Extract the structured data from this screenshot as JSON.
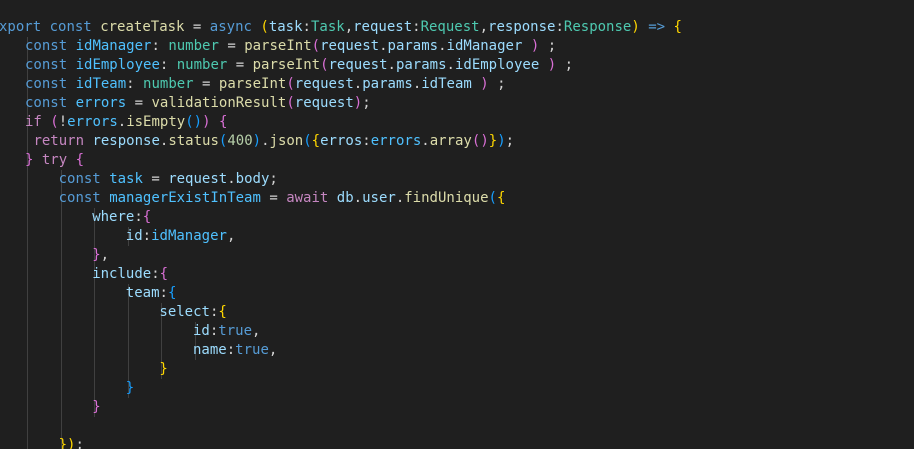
{
  "theme": {
    "background": "#1f1f1f",
    "indent_guide": "#404040",
    "token_colors": {
      "kw": "#569cd6",
      "ctl": "#c586c0",
      "fn": "#dcdcaa",
      "var": "#9cdcfe",
      "const": "#4fc1ff",
      "type": "#4ec9b0",
      "num": "#b5cea8",
      "op": "#d4d4d4",
      "p1": "#ffd700",
      "p2": "#da70d6",
      "p3": "#179fff"
    }
  },
  "code": [
    {
      "indent": 0,
      "tokens": [
        [
          "xport",
          "kw"
        ],
        [
          " ",
          "op"
        ],
        [
          "const",
          "kw"
        ],
        [
          " ",
          "op"
        ],
        [
          "createTask",
          "fn"
        ],
        [
          " = ",
          "op"
        ],
        [
          "async",
          "kw"
        ],
        [
          " ",
          "op"
        ],
        [
          "(",
          "p1"
        ],
        [
          "task",
          "var"
        ],
        [
          ":",
          "op"
        ],
        [
          "Task",
          "type"
        ],
        [
          ",",
          "op"
        ],
        [
          "request",
          "var"
        ],
        [
          ":",
          "op"
        ],
        [
          "Request",
          "type"
        ],
        [
          ",",
          "op"
        ],
        [
          "response",
          "var"
        ],
        [
          ":",
          "op"
        ],
        [
          "Response",
          "type"
        ],
        [
          ")",
          "p1"
        ],
        [
          " ",
          "op"
        ],
        [
          "=>",
          "kw"
        ],
        [
          " ",
          "op"
        ],
        [
          "{",
          "p1"
        ]
      ]
    },
    {
      "indent": 1,
      "tokens": [
        [
          "const",
          "kw"
        ],
        [
          " ",
          "op"
        ],
        [
          "idManager",
          "const"
        ],
        [
          ": ",
          "op"
        ],
        [
          "number",
          "type"
        ],
        [
          " = ",
          "op"
        ],
        [
          "parseInt",
          "fn"
        ],
        [
          "(",
          "p2"
        ],
        [
          "request",
          "var"
        ],
        [
          ".",
          "op"
        ],
        [
          "params",
          "var"
        ],
        [
          ".",
          "op"
        ],
        [
          "idManager",
          "var"
        ],
        [
          " ",
          "op"
        ],
        [
          ")",
          "p2"
        ],
        [
          " ;",
          "op"
        ]
      ]
    },
    {
      "indent": 1,
      "tokens": [
        [
          "const",
          "kw"
        ],
        [
          " ",
          "op"
        ],
        [
          "idEmployee",
          "const"
        ],
        [
          ": ",
          "op"
        ],
        [
          "number",
          "type"
        ],
        [
          " = ",
          "op"
        ],
        [
          "parseInt",
          "fn"
        ],
        [
          "(",
          "p2"
        ],
        [
          "request",
          "var"
        ],
        [
          ".",
          "op"
        ],
        [
          "params",
          "var"
        ],
        [
          ".",
          "op"
        ],
        [
          "idEmployee",
          "var"
        ],
        [
          " ",
          "op"
        ],
        [
          ")",
          "p2"
        ],
        [
          " ;",
          "op"
        ]
      ]
    },
    {
      "indent": 1,
      "tokens": [
        [
          "const",
          "kw"
        ],
        [
          " ",
          "op"
        ],
        [
          "idTeam",
          "const"
        ],
        [
          ": ",
          "op"
        ],
        [
          "number",
          "type"
        ],
        [
          " = ",
          "op"
        ],
        [
          "parseInt",
          "fn"
        ],
        [
          "(",
          "p2"
        ],
        [
          "request",
          "var"
        ],
        [
          ".",
          "op"
        ],
        [
          "params",
          "var"
        ],
        [
          ".",
          "op"
        ],
        [
          "idTeam",
          "var"
        ],
        [
          " ",
          "op"
        ],
        [
          ")",
          "p2"
        ],
        [
          " ;",
          "op"
        ]
      ]
    },
    {
      "indent": 1,
      "tokens": [
        [
          "const",
          "kw"
        ],
        [
          " ",
          "op"
        ],
        [
          "errors",
          "const"
        ],
        [
          " = ",
          "op"
        ],
        [
          "validationResult",
          "fn"
        ],
        [
          "(",
          "p2"
        ],
        [
          "request",
          "var"
        ],
        [
          ")",
          "p2"
        ],
        [
          ";",
          "op"
        ]
      ]
    },
    {
      "indent": 1,
      "tokens": [
        [
          "if",
          "ctl"
        ],
        [
          " ",
          "op"
        ],
        [
          "(",
          "p2"
        ],
        [
          "!",
          "op"
        ],
        [
          "errors",
          "const"
        ],
        [
          ".",
          "op"
        ],
        [
          "isEmpty",
          "fn"
        ],
        [
          "(",
          "p3"
        ],
        [
          ")",
          "p3"
        ],
        [
          ")",
          "p2"
        ],
        [
          " ",
          "op"
        ],
        [
          "{",
          "p2"
        ]
      ]
    },
    {
      "indent": 1,
      "tokens": [
        [
          " ",
          "op"
        ],
        [
          "return",
          "ctl"
        ],
        [
          " ",
          "op"
        ],
        [
          "response",
          "var"
        ],
        [
          ".",
          "op"
        ],
        [
          "status",
          "fn"
        ],
        [
          "(",
          "p3"
        ],
        [
          "400",
          "num"
        ],
        [
          ")",
          "p3"
        ],
        [
          ".",
          "op"
        ],
        [
          "json",
          "fn"
        ],
        [
          "(",
          "p3"
        ],
        [
          "{",
          "p1"
        ],
        [
          "erros",
          "var"
        ],
        [
          ":",
          "op"
        ],
        [
          "errors",
          "const"
        ],
        [
          ".",
          "op"
        ],
        [
          "array",
          "fn"
        ],
        [
          "(",
          "p2"
        ],
        [
          ")",
          "p2"
        ],
        [
          "}",
          "p1"
        ],
        [
          ")",
          "p3"
        ],
        [
          ";",
          "op"
        ]
      ]
    },
    {
      "indent": 1,
      "tokens": [
        [
          "}",
          "p2"
        ],
        [
          " ",
          "op"
        ],
        [
          "try",
          "ctl"
        ],
        [
          " ",
          "op"
        ],
        [
          "{",
          "p2"
        ]
      ]
    },
    {
      "indent": 2,
      "tokens": [
        [
          "const",
          "kw"
        ],
        [
          " ",
          "op"
        ],
        [
          "task",
          "const"
        ],
        [
          " = ",
          "op"
        ],
        [
          "request",
          "var"
        ],
        [
          ".",
          "op"
        ],
        [
          "body",
          "var"
        ],
        [
          ";",
          "op"
        ]
      ]
    },
    {
      "indent": 2,
      "tokens": [
        [
          "const",
          "kw"
        ],
        [
          " ",
          "op"
        ],
        [
          "managerExistInTeam",
          "const"
        ],
        [
          " = ",
          "op"
        ],
        [
          "await",
          "ctl"
        ],
        [
          " ",
          "op"
        ],
        [
          "db",
          "var"
        ],
        [
          ".",
          "op"
        ],
        [
          "user",
          "var"
        ],
        [
          ".",
          "op"
        ],
        [
          "findUnique",
          "fn"
        ],
        [
          "(",
          "p3"
        ],
        [
          "{",
          "p1"
        ]
      ]
    },
    {
      "indent": 3,
      "tokens": [
        [
          "where",
          "var"
        ],
        [
          ":",
          "op"
        ],
        [
          "{",
          "p2"
        ]
      ]
    },
    {
      "indent": 4,
      "tokens": [
        [
          "id",
          "var"
        ],
        [
          ":",
          "op"
        ],
        [
          "idManager",
          "const"
        ],
        [
          ",",
          "op"
        ]
      ]
    },
    {
      "indent": 3,
      "tokens": [
        [
          "}",
          "p2"
        ],
        [
          ",",
          "op"
        ]
      ]
    },
    {
      "indent": 3,
      "tokens": [
        [
          "include",
          "var"
        ],
        [
          ":",
          "op"
        ],
        [
          "{",
          "p2"
        ]
      ]
    },
    {
      "indent": 4,
      "tokens": [
        [
          "team",
          "var"
        ],
        [
          ":",
          "op"
        ],
        [
          "{",
          "p3"
        ]
      ]
    },
    {
      "indent": 5,
      "tokens": [
        [
          "select",
          "var"
        ],
        [
          ":",
          "op"
        ],
        [
          "{",
          "p1"
        ]
      ]
    },
    {
      "indent": 6,
      "tokens": [
        [
          "id",
          "var"
        ],
        [
          ":",
          "op"
        ],
        [
          "true",
          "kw"
        ],
        [
          ",",
          "op"
        ]
      ]
    },
    {
      "indent": 6,
      "tokens": [
        [
          "name",
          "var"
        ],
        [
          ":",
          "op"
        ],
        [
          "true",
          "kw"
        ],
        [
          ",",
          "op"
        ]
      ]
    },
    {
      "indent": 5,
      "tokens": [
        [
          "}",
          "p1"
        ]
      ]
    },
    {
      "indent": 4,
      "tokens": [
        [
          "}",
          "p3"
        ]
      ]
    },
    {
      "indent": 3,
      "tokens": [
        [
          "}",
          "p2"
        ]
      ]
    },
    {
      "indent": 2,
      "tokens": []
    },
    {
      "indent": 2,
      "tokens": [
        [
          "})",
          "p1"
        ],
        [
          ";",
          "op"
        ]
      ]
    }
  ]
}
